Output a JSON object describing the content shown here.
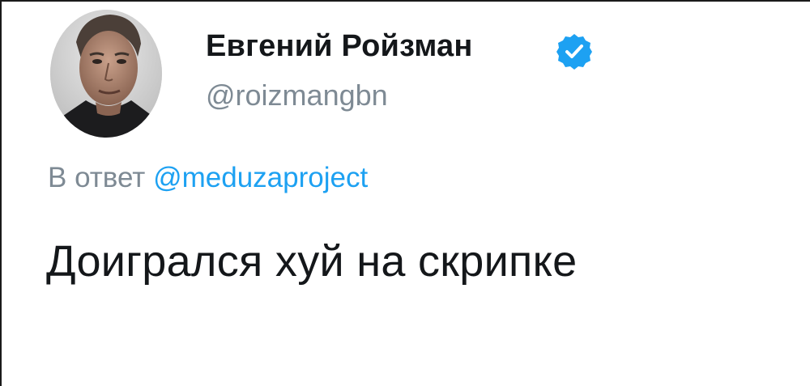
{
  "tweet": {
    "author": {
      "display_name": "Евгений Ройзман",
      "handle": "@roizmangbn",
      "verified_icon": "verified-badge-icon",
      "verified_color": "#1da1f2"
    },
    "reply": {
      "prefix": "В ответ",
      "mention": "@meduzaproject",
      "mention_color": "#1da1f2"
    },
    "text": "Доигрался хуй на скрипке"
  }
}
